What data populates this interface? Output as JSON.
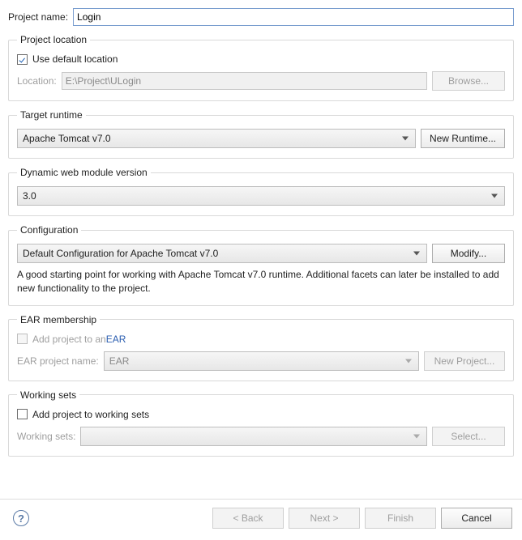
{
  "projectName": {
    "label": "Project name:",
    "value": "Login"
  },
  "projectLocation": {
    "legend": "Project location",
    "useDefaultLabel": "Use default location",
    "useDefaultChecked": true,
    "locationLabel": "Location:",
    "locationValue": "E:\\Project\\ULogin",
    "browseLabel": "Browse..."
  },
  "targetRuntime": {
    "legend": "Target runtime",
    "value": "Apache Tomcat v7.0",
    "newRuntimeLabel": "New Runtime..."
  },
  "dynamicWeb": {
    "legend": "Dynamic web module version",
    "value": "3.0"
  },
  "configuration": {
    "legend": "Configuration",
    "value": "Default Configuration for Apache Tomcat v7.0",
    "modifyLabel": "Modify...",
    "description": "A good starting point for working with Apache Tomcat v7.0 runtime. Additional facets can later be installed to add new functionality to the project."
  },
  "earMembership": {
    "legend": "EAR membership",
    "addLabelPrefix": "Add project to an ",
    "addLabelLink": "EAR",
    "addChecked": false,
    "projectNameLabel": "EAR project name:",
    "projectNameValue": "EAR",
    "newProjectLabel": "New Project..."
  },
  "workingSets": {
    "legend": "Working sets",
    "addLabel": "Add project to working sets",
    "addChecked": false,
    "wsLabel": "Working sets:",
    "wsValue": "",
    "selectLabel": "Select..."
  },
  "footer": {
    "back": "< Back",
    "next": "Next >",
    "finish": "Finish",
    "cancel": "Cancel"
  },
  "help": {
    "glyph": "?"
  }
}
